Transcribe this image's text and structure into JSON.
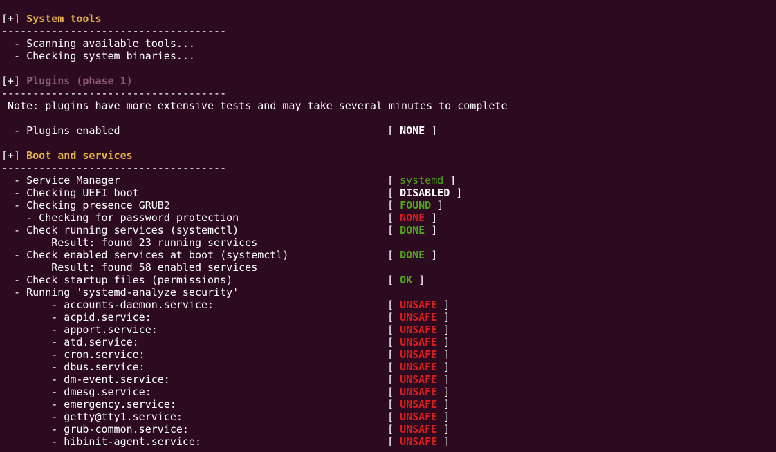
{
  "colors": {
    "background": "#2c0a1f",
    "text": "#ffffff",
    "section_header": "#e4b04a",
    "section_header_dim": "#8a5a78",
    "green": "#4ea41a",
    "red": "#d51e1e"
  },
  "lines": [
    {
      "kind": "section",
      "prefix": "[+] ",
      "title": "System tools"
    },
    {
      "kind": "text",
      "text": "------------------------------------"
    },
    {
      "kind": "text",
      "text": "  - Scanning available tools..."
    },
    {
      "kind": "text",
      "text": "  - Checking system binaries..."
    },
    {
      "kind": "blank"
    },
    {
      "kind": "section",
      "prefix": "[+] ",
      "title": "Plugins (phase 1)",
      "dim": true
    },
    {
      "kind": "text",
      "text": "------------------------------------"
    },
    {
      "kind": "text",
      "text": " Note: plugins have more extensive tests and may take several minutes to complete"
    },
    {
      "kind": "blank"
    },
    {
      "kind": "check",
      "text": "  - Plugins enabled",
      "status": "NONE",
      "color": "white"
    },
    {
      "kind": "blank"
    },
    {
      "kind": "section",
      "prefix": "[+] ",
      "title": "Boot and services"
    },
    {
      "kind": "text",
      "text": "------------------------------------"
    },
    {
      "kind": "check",
      "text": "  - Service Manager",
      "status": "systemd",
      "color": "green",
      "normal": true
    },
    {
      "kind": "check",
      "text": "  - Checking UEFI boot",
      "status": "DISABLED",
      "color": "white"
    },
    {
      "kind": "check",
      "text": "  - Checking presence GRUB2",
      "status": "FOUND",
      "color": "green"
    },
    {
      "kind": "check",
      "text": "    - Checking for password protection",
      "status": "NONE",
      "color": "red"
    },
    {
      "kind": "check",
      "text": "  - Check running services (systemctl)",
      "status": "DONE",
      "color": "green"
    },
    {
      "kind": "text",
      "text": "        Result: found 23 running services"
    },
    {
      "kind": "check",
      "text": "  - Check enabled services at boot (systemctl)",
      "status": "DONE",
      "color": "green"
    },
    {
      "kind": "text",
      "text": "        Result: found 58 enabled services"
    },
    {
      "kind": "check",
      "text": "  - Check startup files (permissions)",
      "status": "OK",
      "color": "green"
    },
    {
      "kind": "text",
      "text": "  - Running 'systemd-analyze security'"
    },
    {
      "kind": "check",
      "text": "        - accounts-daemon.service:",
      "status": "UNSAFE",
      "color": "red"
    },
    {
      "kind": "check",
      "text": "        - acpid.service:",
      "status": "UNSAFE",
      "color": "red"
    },
    {
      "kind": "check",
      "text": "        - apport.service:",
      "status": "UNSAFE",
      "color": "red"
    },
    {
      "kind": "check",
      "text": "        - atd.service:",
      "status": "UNSAFE",
      "color": "red"
    },
    {
      "kind": "check",
      "text": "        - cron.service:",
      "status": "UNSAFE",
      "color": "red"
    },
    {
      "kind": "check",
      "text": "        - dbus.service:",
      "status": "UNSAFE",
      "color": "red"
    },
    {
      "kind": "check",
      "text": "        - dm-event.service:",
      "status": "UNSAFE",
      "color": "red"
    },
    {
      "kind": "check",
      "text": "        - dmesg.service:",
      "status": "UNSAFE",
      "color": "red"
    },
    {
      "kind": "check",
      "text": "        - emergency.service:",
      "status": "UNSAFE",
      "color": "red"
    },
    {
      "kind": "check",
      "text": "        - getty@tty1.service:",
      "status": "UNSAFE",
      "color": "red"
    },
    {
      "kind": "check",
      "text": "        - grub-common.service:",
      "status": "UNSAFE",
      "color": "red"
    },
    {
      "kind": "check",
      "text": "        - hibinit-agent.service:",
      "status": "UNSAFE",
      "color": "red"
    }
  ]
}
